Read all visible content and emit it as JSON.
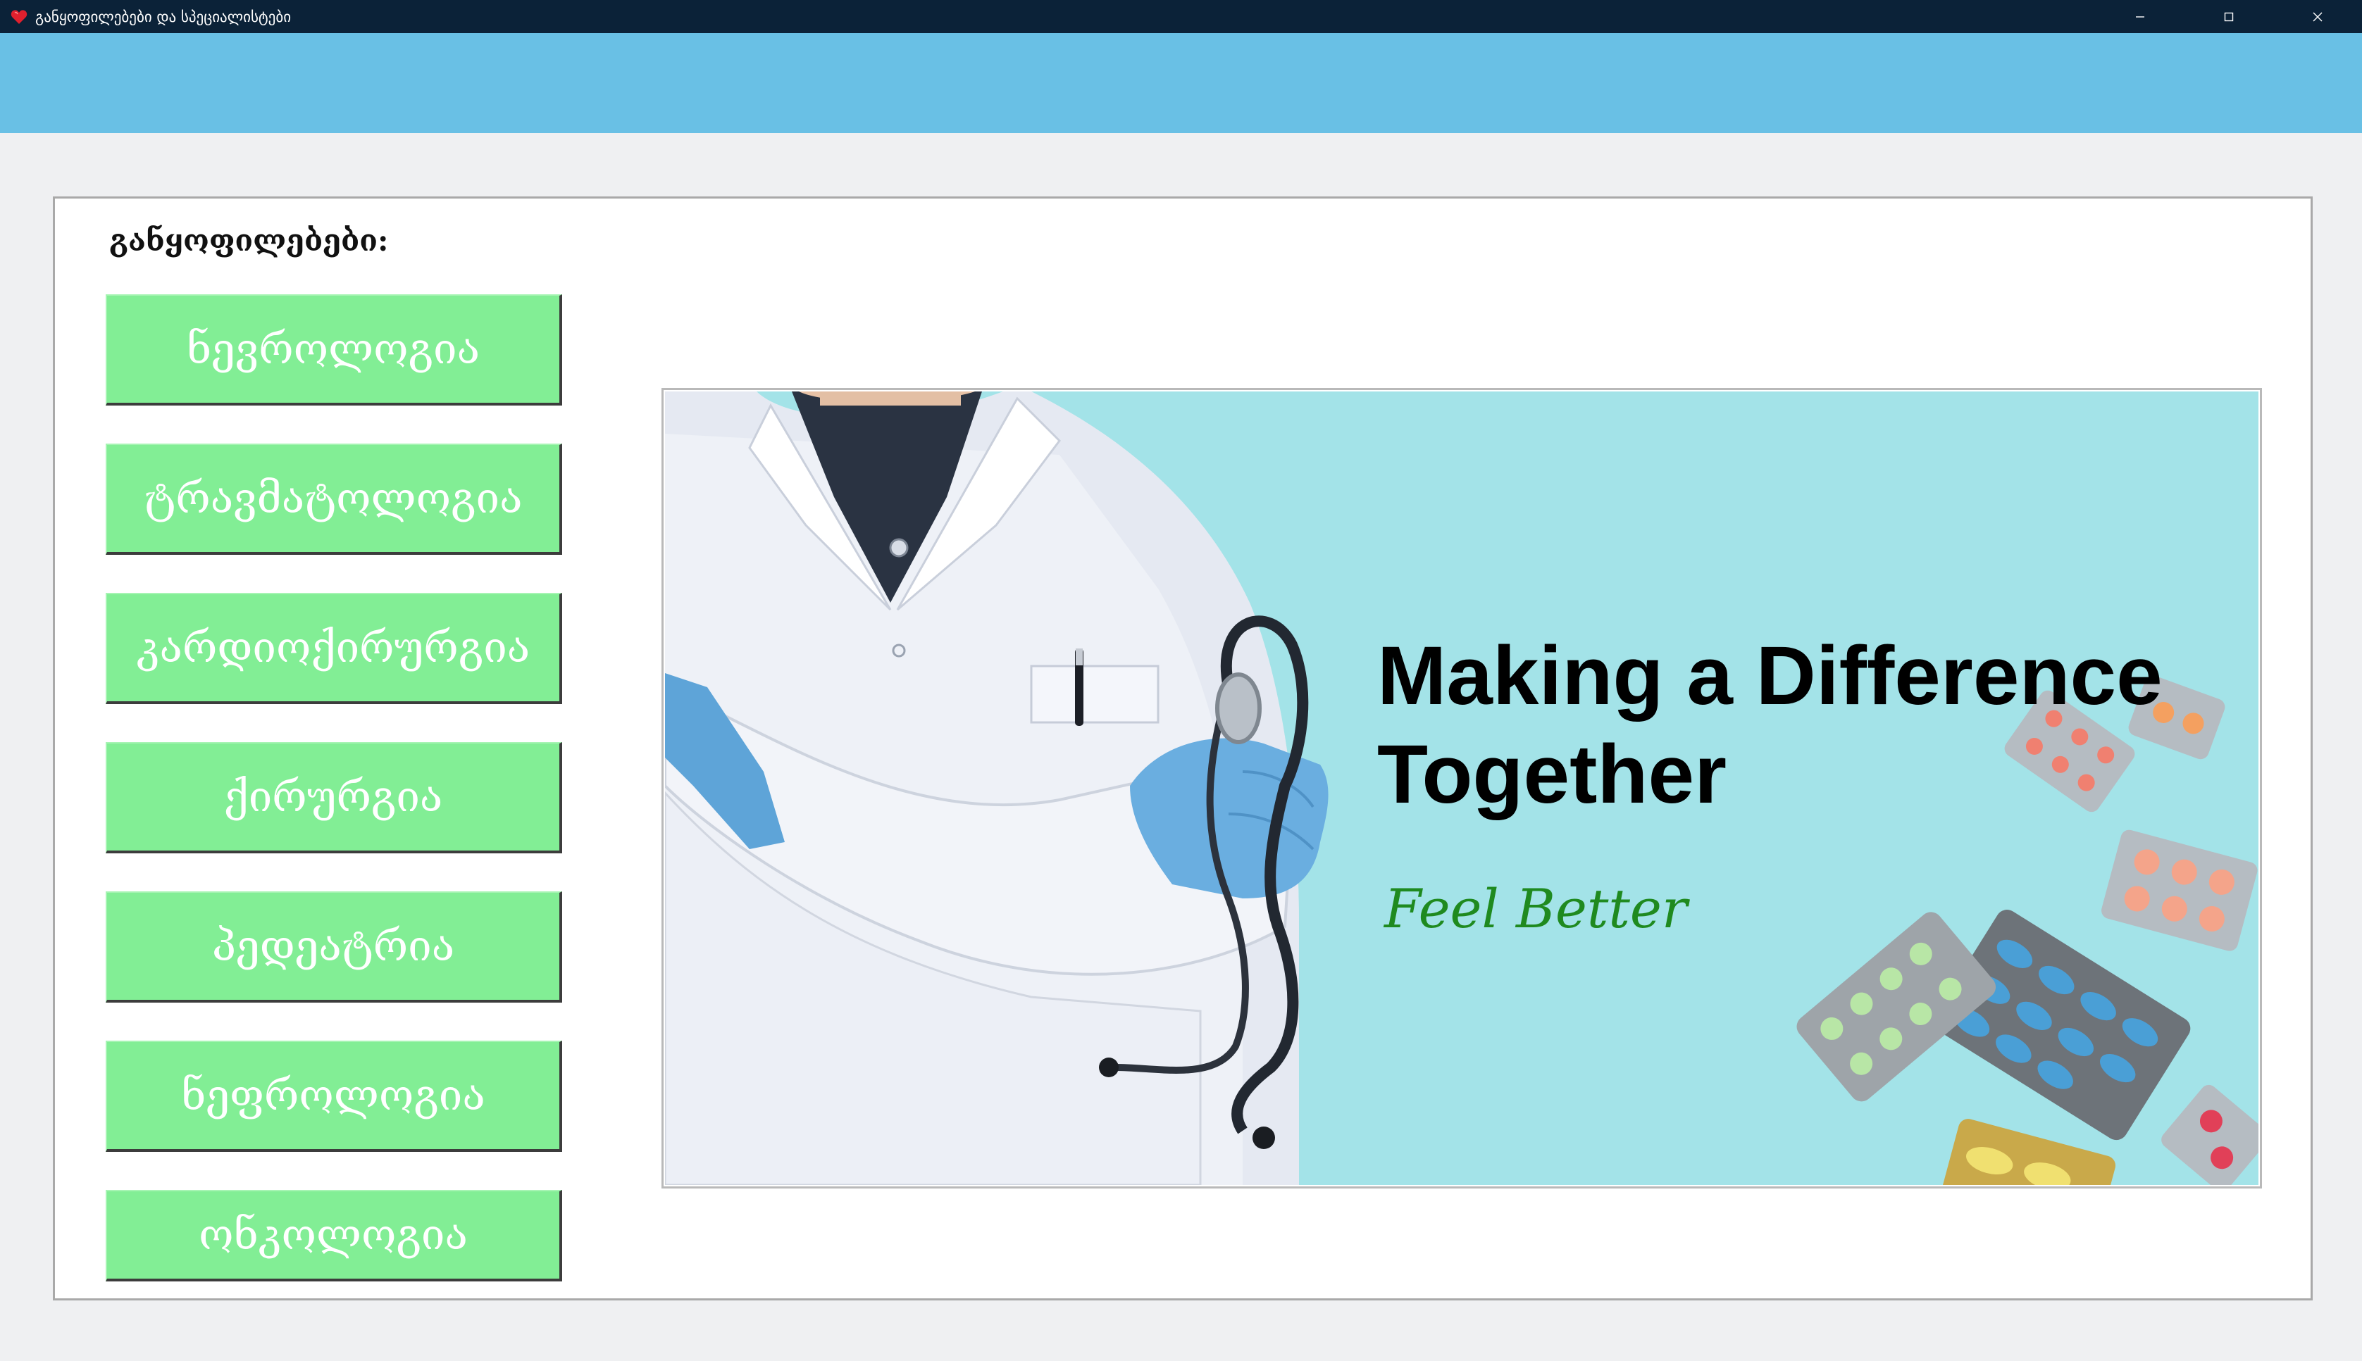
{
  "window": {
    "title": "განყოფილებები და სპეციალისტები",
    "icon": "heart-icon",
    "controls": [
      "minimize-icon",
      "maximize-icon",
      "close-icon"
    ]
  },
  "departments_section": {
    "label": "განყოფილებები:",
    "buttons": [
      {
        "label": "ნევროლოგია"
      },
      {
        "label": "ტრავმატოლოგია"
      },
      {
        "label": "კარდიოქირურგია"
      },
      {
        "label": "ქირურგია"
      },
      {
        "label": "პედეატრია"
      },
      {
        "label": "ნეფროლოგია"
      },
      {
        "label": "ონკოლოგია"
      }
    ]
  },
  "banner": {
    "headline_line1": "Making a Difference",
    "headline_line2": "Together",
    "tagline": "Feel Better"
  },
  "colors": {
    "titlebar": "#0b2238",
    "top_band": "#69c0e5",
    "button_fill": "#82ee95",
    "banner_background": "#a3e3e8",
    "tagline": "#1f8a1f"
  }
}
